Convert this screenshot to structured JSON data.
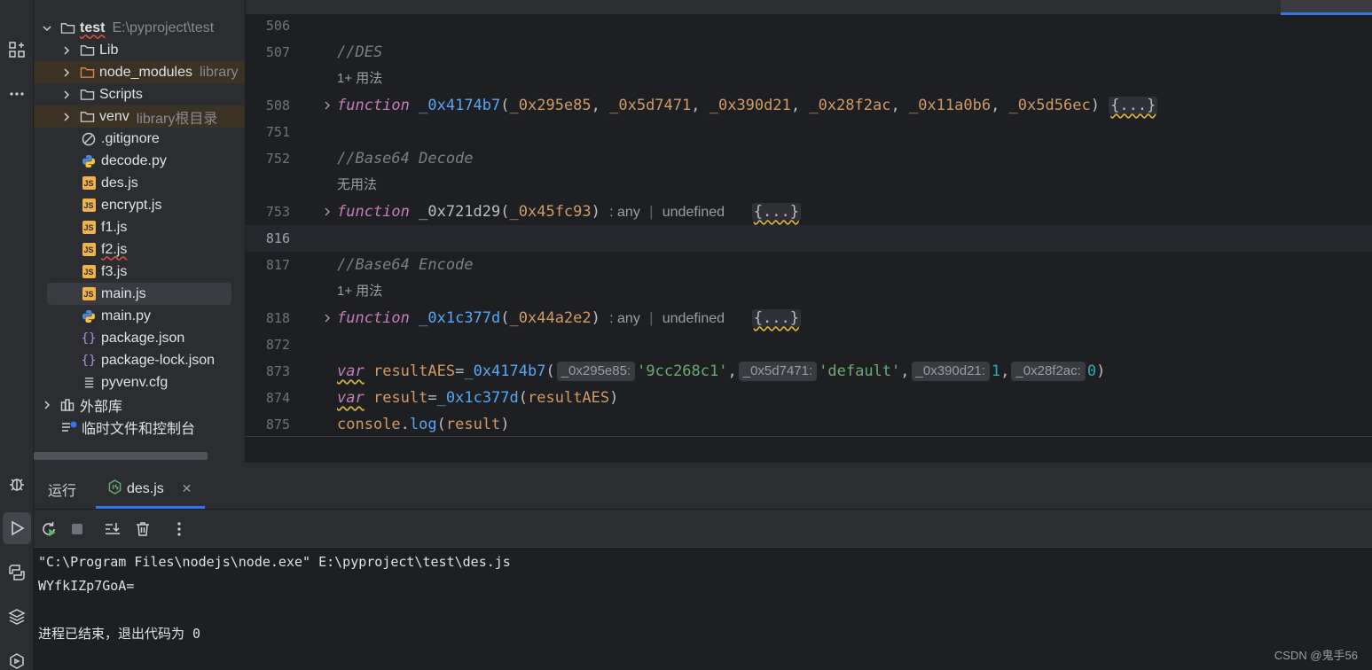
{
  "tree": {
    "root": {
      "name": "test",
      "path": "E:\\pyproject\\test"
    },
    "items": [
      {
        "name": "Lib",
        "type": "folder",
        "note": ""
      },
      {
        "name": "node_modules",
        "type": "folder-excluded",
        "note": "library"
      },
      {
        "name": "Scripts",
        "type": "folder",
        "note": ""
      },
      {
        "name": "venv",
        "type": "folder-excluded",
        "note": "library根目录"
      },
      {
        "name": ".gitignore",
        "type": "ignore",
        "note": ""
      },
      {
        "name": "decode.py",
        "type": "py",
        "note": ""
      },
      {
        "name": "des.js",
        "type": "js",
        "note": ""
      },
      {
        "name": "encrypt.js",
        "type": "js",
        "note": ""
      },
      {
        "name": "f1.js",
        "type": "js",
        "note": ""
      },
      {
        "name": "f2.js",
        "type": "js",
        "note": ""
      },
      {
        "name": "f3.js",
        "type": "js",
        "note": ""
      },
      {
        "name": "main.js",
        "type": "js",
        "note": ""
      },
      {
        "name": "main.py",
        "type": "py",
        "note": ""
      },
      {
        "name": "package.json",
        "type": "json",
        "note": ""
      },
      {
        "name": "package-lock.json",
        "type": "json",
        "note": ""
      },
      {
        "name": "pyvenv.cfg",
        "type": "cfg",
        "note": ""
      }
    ],
    "external_libs": "外部库",
    "scratches": "临时文件和控制台"
  },
  "editor": {
    "lines": {
      "l506": "506",
      "l507": "507",
      "l508": "508",
      "l751": "751",
      "l752": "752",
      "l753": "753",
      "l816": "816",
      "l817": "817",
      "l818": "818",
      "l872": "872",
      "l873": "873",
      "l874": "874",
      "l875": "875"
    },
    "comment_des": "//DES",
    "usage_1": "1+ 用法",
    "comment_decode": "//Base64 Decode",
    "usage_none": "无用法",
    "comment_encode": "//Base64 Encode",
    "usage_2": "1+ 用法",
    "kw_function": "function",
    "kw_var": "var",
    "fn1": {
      "name": "_0x4174b7",
      "params": [
        "_0x295e85",
        "_0x5d7471",
        "_0x390d21",
        "_0x28f2ac",
        "_0x11a0b6",
        "_0x5d56ec"
      ]
    },
    "fn2": {
      "name": "_0x721d29",
      "param": "_0x45fc93",
      "type_any": ": any",
      "type_undef": "undefined"
    },
    "fn3": {
      "name": "_0x1c377d",
      "param": "_0x44a2e2",
      "type_any": ": any",
      "type_undef": "undefined"
    },
    "folded": "{...}",
    "line873": {
      "var": "resultAES",
      "call": "_0x4174b7",
      "hints": [
        "_0x295e85:",
        "_0x5d7471:",
        "_0x390d21:",
        "_0x28f2ac:"
      ],
      "args": [
        "'9cc268c1'",
        "'default'",
        "1",
        "0"
      ]
    },
    "line874": {
      "var": "result",
      "call": "_0x1c377d",
      "arg": "resultAES"
    },
    "line875": {
      "obj": "console",
      "method": "log",
      "arg": "result"
    }
  },
  "run": {
    "title": "运行",
    "tab_label": "des.js",
    "console": [
      "\"C:\\Program Files\\nodejs\\node.exe\" E:\\pyproject\\test\\des.js",
      "WYfkIZp7GoA=",
      "",
      "进程已结束，退出代码为 0"
    ]
  },
  "watermark": "CSDN @鬼手56",
  "colors": {
    "accent": "#3574f0",
    "keyword": "#c77dbb",
    "function": "#56a8f5",
    "param": "#d19a66",
    "string": "#6aab73",
    "number": "#2aacb8",
    "comment": "#7a7e85"
  }
}
